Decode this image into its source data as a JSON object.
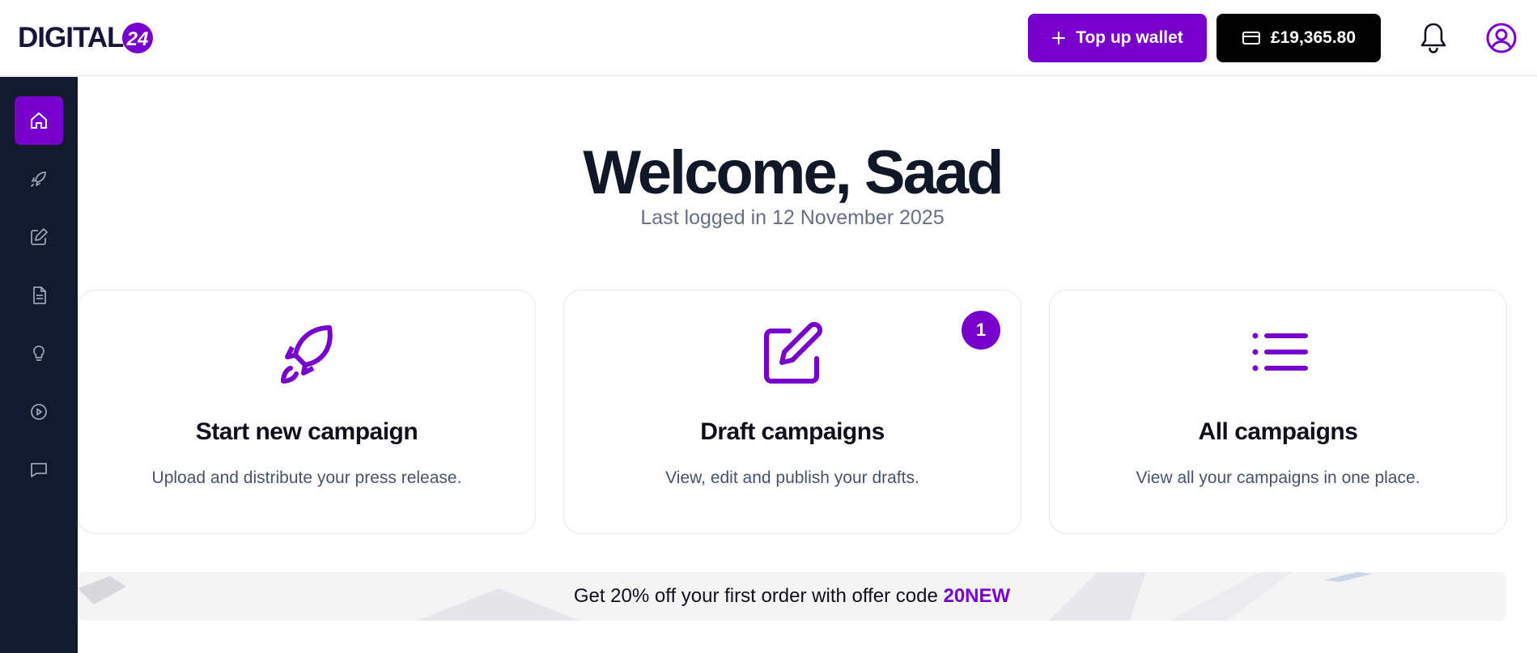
{
  "header": {
    "logo_text": "DIGITAL",
    "logo_badge": "24",
    "topup_label": "Top up wallet",
    "wallet_balance": "£19,365.80",
    "icons": {
      "topup": "plus-icon",
      "wallet": "credit-card-icon",
      "notifications": "bell-icon",
      "profile": "user-circle-icon"
    }
  },
  "sidebar": {
    "items": [
      {
        "name": "home",
        "icon": "home-icon",
        "active": true
      },
      {
        "name": "campaigns",
        "icon": "rocket-icon",
        "active": false
      },
      {
        "name": "drafts",
        "icon": "edit-icon",
        "active": false
      },
      {
        "name": "documents",
        "icon": "document-icon",
        "active": false
      },
      {
        "name": "ideas",
        "icon": "lightbulb-icon",
        "active": false
      },
      {
        "name": "videos",
        "icon": "play-circle-icon",
        "active": false
      },
      {
        "name": "messages",
        "icon": "chat-icon",
        "active": false
      }
    ]
  },
  "main": {
    "welcome": "Welcome, Saad",
    "last_logged": "Last logged in 12 November 2025",
    "cards": [
      {
        "icon": "rocket-icon",
        "title": "Start new campaign",
        "description": "Upload and distribute your press release."
      },
      {
        "icon": "edit-icon",
        "title": "Draft campaigns",
        "description": "View, edit and publish your drafts.",
        "badge": "1"
      },
      {
        "icon": "list-icon",
        "title": "All campaigns",
        "description": "View all your campaigns in one place."
      }
    ],
    "promo": {
      "text": "Get 20% off your first order with offer code",
      "code": "20NEW"
    }
  },
  "colors": {
    "accent": "#7700cc",
    "sidebar": "#131a2e",
    "heading": "#101828",
    "muted": "#667085"
  }
}
